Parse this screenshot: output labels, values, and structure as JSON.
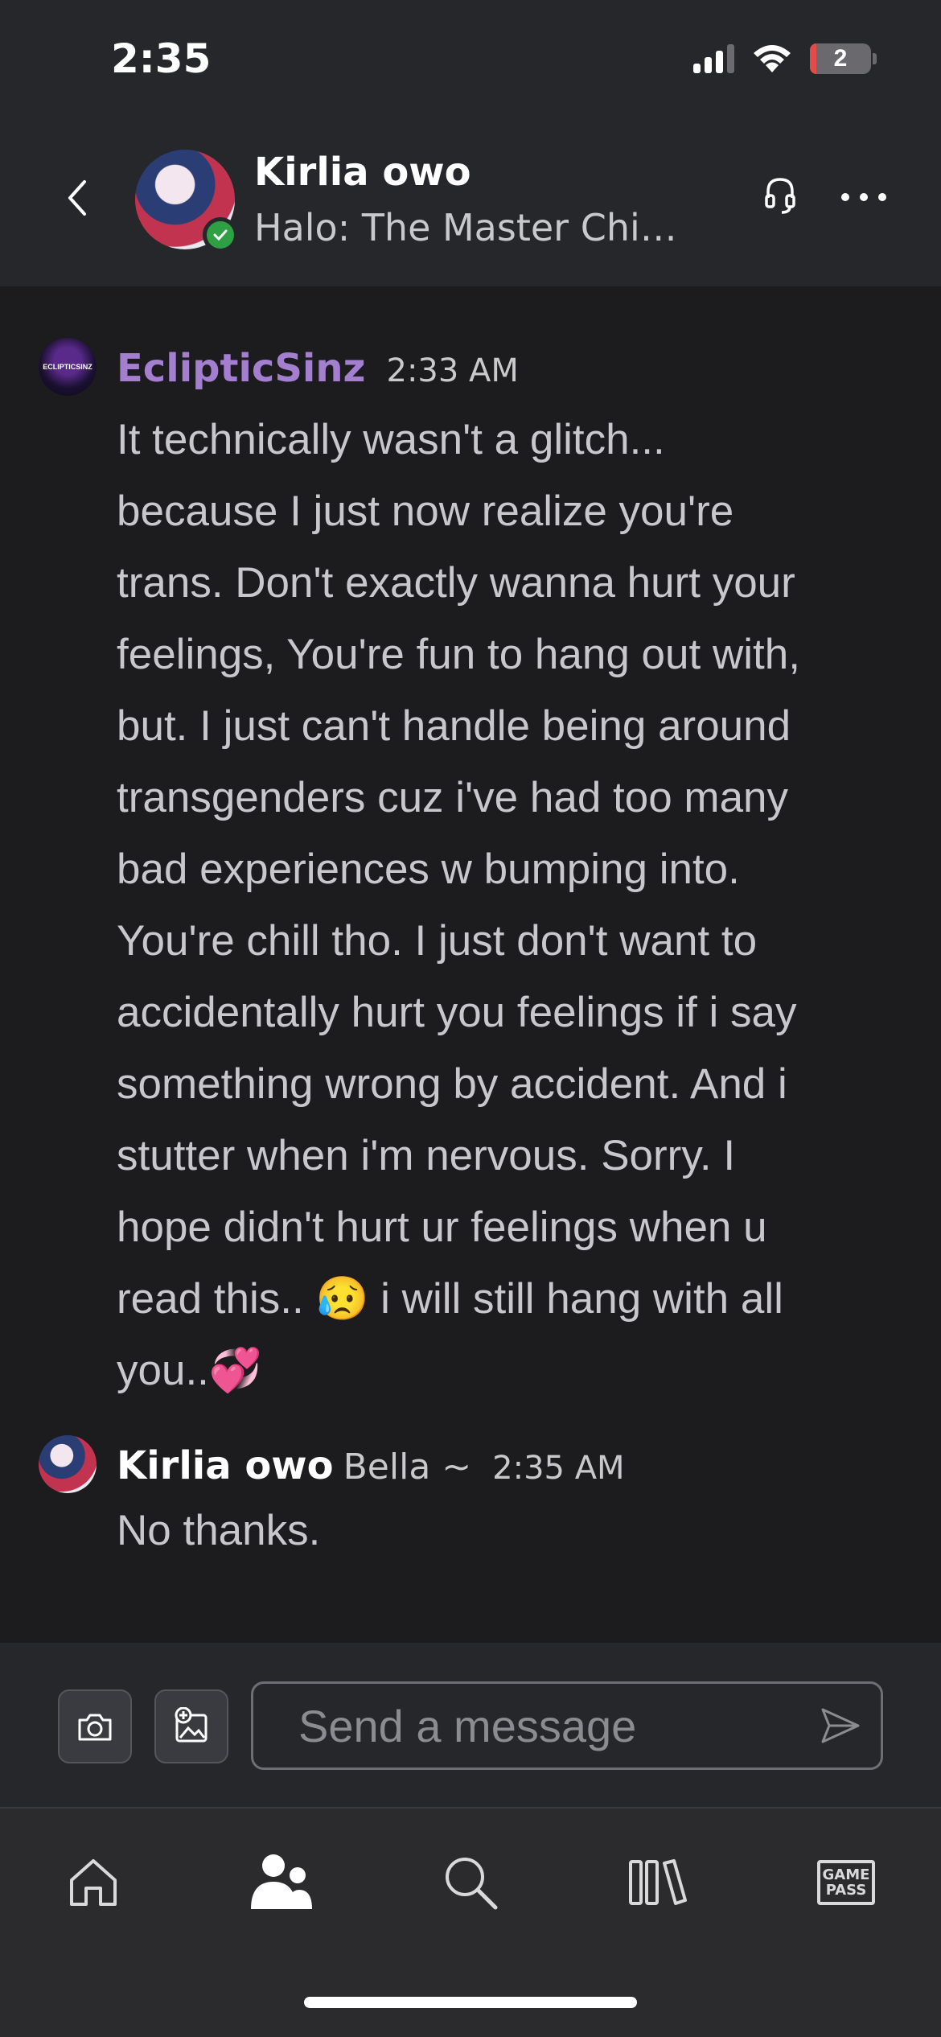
{
  "status_bar": {
    "time": "2:35",
    "battery": "2"
  },
  "header": {
    "name": "Kirlia owo",
    "status": "Halo: The Master Chief Collection"
  },
  "messages": [
    {
      "author": "EclipticSinz",
      "author_color": "#a47fcf",
      "avatar_text": "ECLIPTICSINZ",
      "time": "2:33 AM",
      "lines": [
        "It technically wasn't a glitch...",
        "because I just now realize you're",
        "trans. Don't exactly wanna hurt your",
        "feelings, You're fun to hang out with,",
        "but. I just can't handle being around",
        "transgenders cuz i've had too many",
        "bad experiences w bumping into.",
        "You're chill tho. I just don't want to",
        "accidentally hurt you feelings if i say",
        "something wrong by accident. And i",
        "stutter when i'm nervous. Sorry. I",
        "hope didn't hurt ur feelings when u",
        "read this.. 😥 i will still hang with all",
        "you..💞"
      ]
    },
    {
      "author": "Kirlia owo",
      "author_color": "#ffffff",
      "subtitle": "Bella ~",
      "time": "2:35 AM",
      "text": "No thanks."
    }
  ],
  "composer": {
    "placeholder": "Send a message"
  },
  "nav": {
    "items": [
      "home-icon",
      "friends-icon",
      "search-icon",
      "library-icon",
      "game-pass-icon"
    ],
    "game_pass_line1": "GAME",
    "game_pass_line2": "PASS",
    "active": "friends-icon"
  }
}
